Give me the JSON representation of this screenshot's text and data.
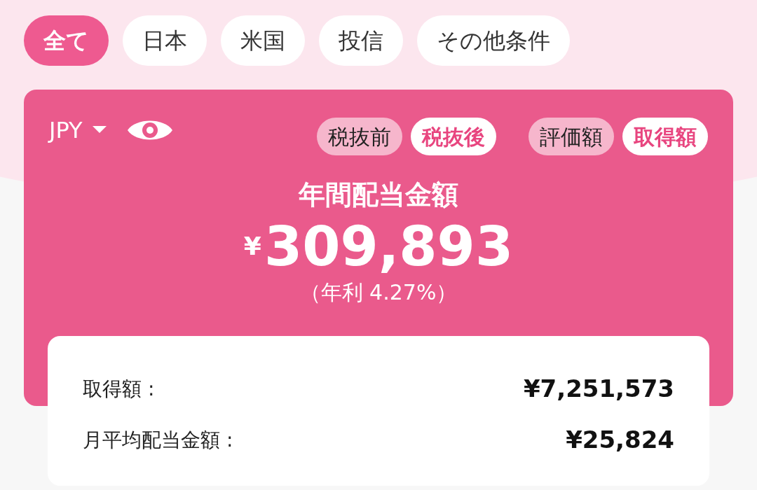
{
  "filters": [
    {
      "label": "全て",
      "selected": true
    },
    {
      "label": "日本",
      "selected": false
    },
    {
      "label": "米国",
      "selected": false
    },
    {
      "label": "投信",
      "selected": false
    },
    {
      "label": "その他条件",
      "selected": false
    }
  ],
  "card": {
    "currency": "JPY",
    "tax_toggle": [
      {
        "label": "税抜前",
        "selected": false
      },
      {
        "label": "税抜後",
        "selected": true
      }
    ],
    "basis_toggle": [
      {
        "label": "評価額",
        "selected": false
      },
      {
        "label": "取得額",
        "selected": true
      }
    ],
    "title": "年間配当金額",
    "currency_symbol": "¥",
    "amount": "309,893",
    "yield": "（年利 4.27%）"
  },
  "summary": [
    {
      "label": "取得額 :",
      "value": "¥7,251,573"
    },
    {
      "label": "月平均配当金額 :",
      "value": "¥25,824"
    }
  ]
}
